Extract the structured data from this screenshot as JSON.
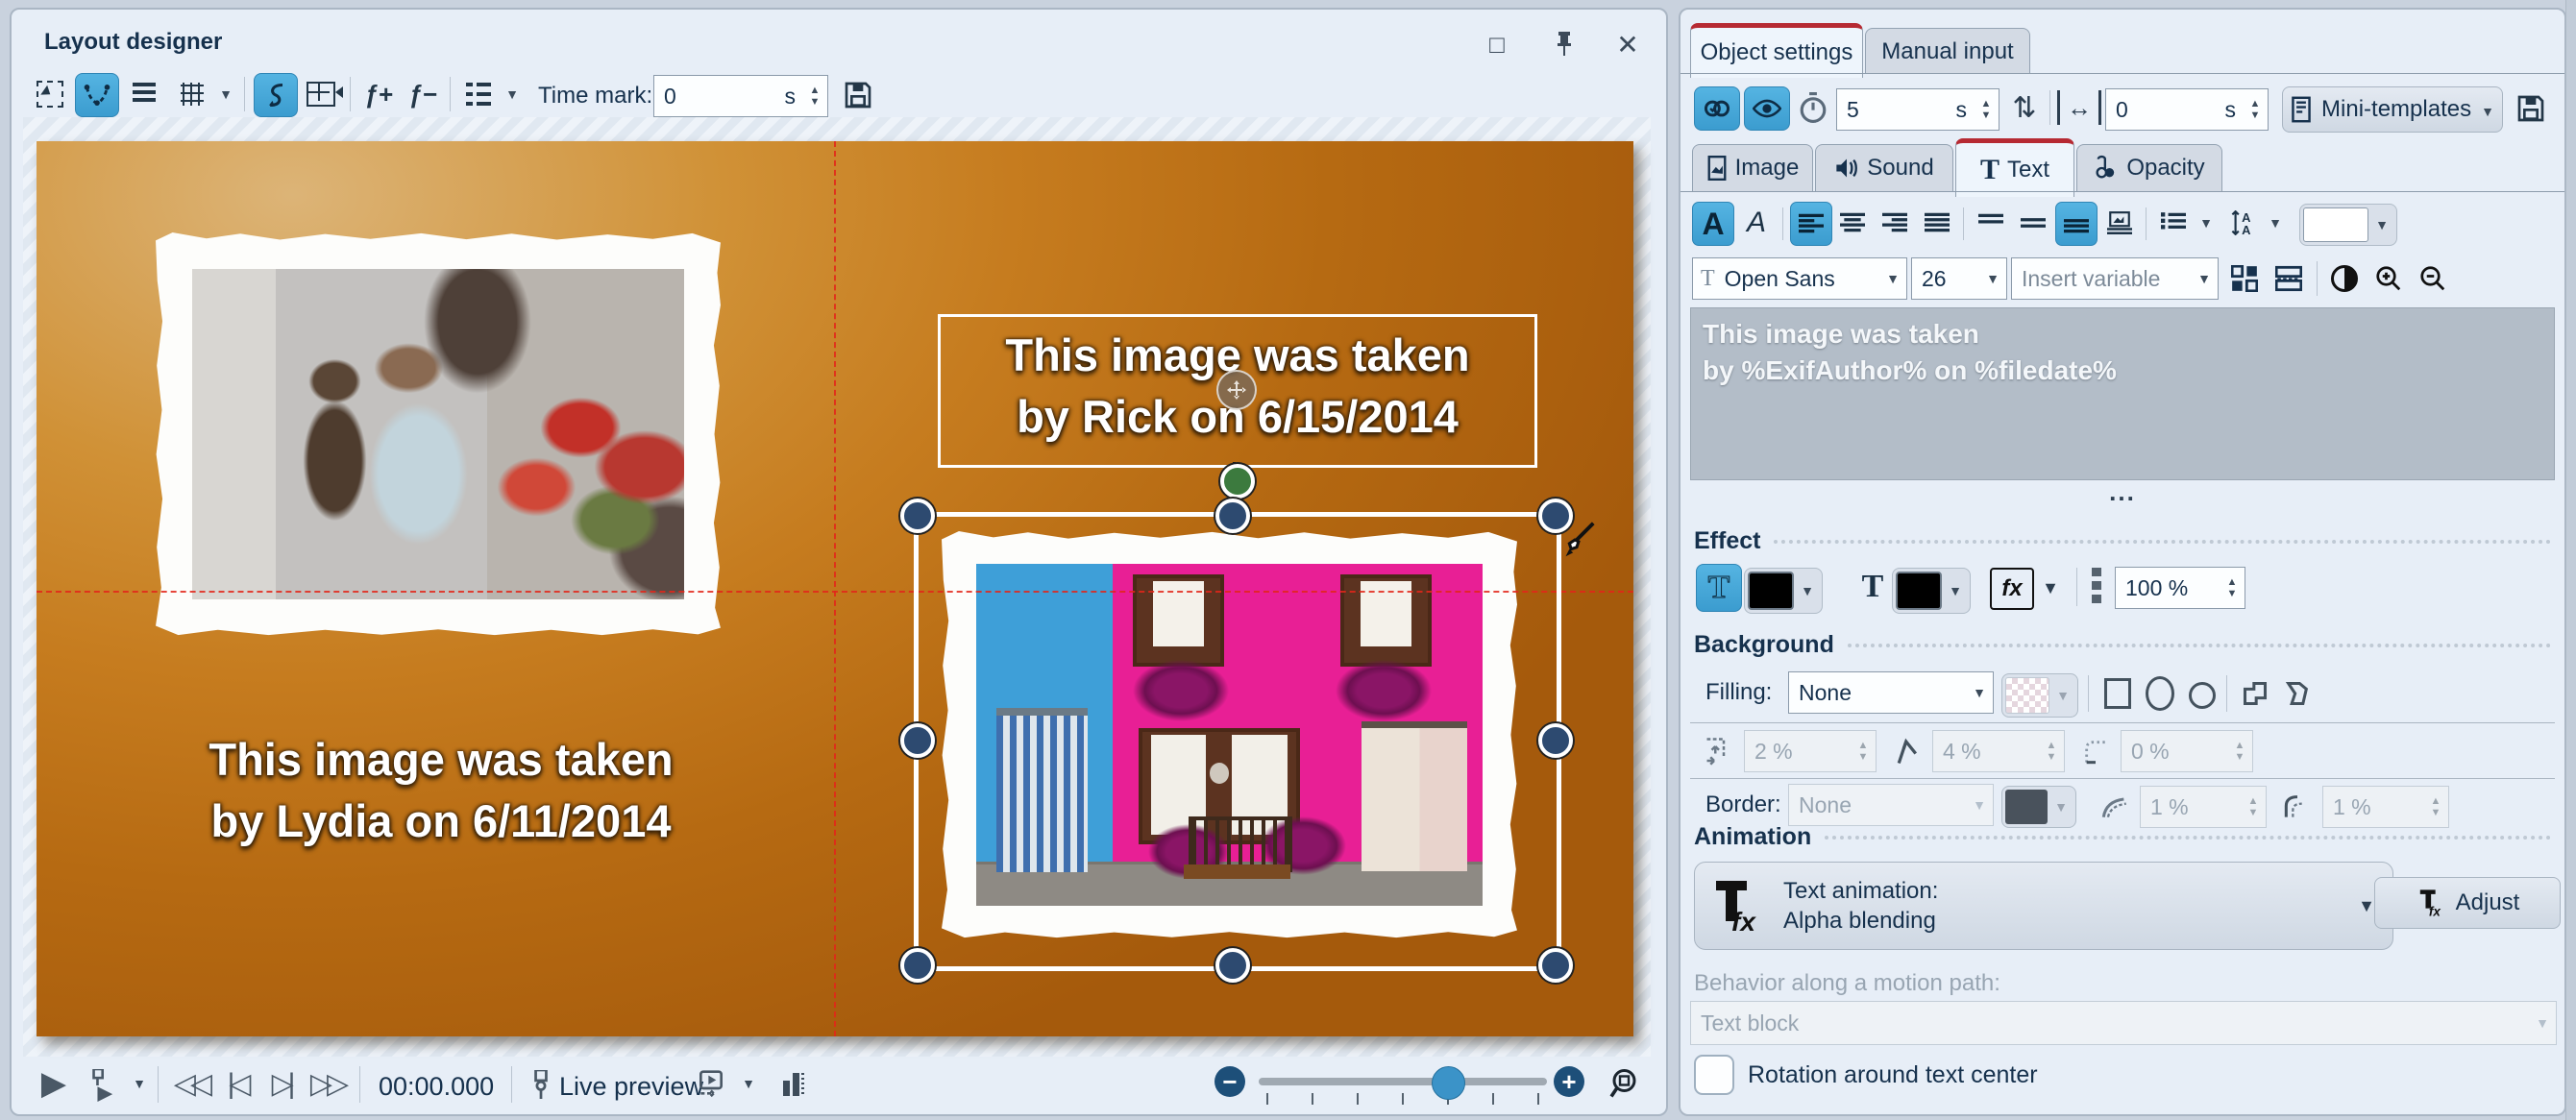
{
  "layout_designer": {
    "title": "Layout designer",
    "toolbar": {
      "time_mark_label": "Time mark:",
      "time_mark_value": "0",
      "time_mark_unit": "s"
    },
    "canvas": {
      "left_caption_line1": "This image was taken",
      "left_caption_line2": "by Lydia on 6/11/2014",
      "selected_text_line1": "This image was taken",
      "selected_text_line2": "by Rick on 6/15/2014"
    },
    "playback": {
      "time_display": "00:00.000",
      "live_preview_label": "Live preview"
    }
  },
  "object_settings": {
    "tabs": [
      {
        "label": "Object settings"
      },
      {
        "label": "Manual input"
      }
    ],
    "toolbar": {
      "duration_value": "5",
      "duration_unit": "s",
      "offset_value": "0",
      "offset_unit": "s",
      "mini_templates_label": "Mini-templates"
    },
    "content_tabs": [
      {
        "label": "Image"
      },
      {
        "label": "Sound"
      },
      {
        "label": "Text"
      },
      {
        "label": "Opacity"
      }
    ],
    "text_format": {
      "font_name": "Open Sans",
      "font_size": "26",
      "insert_variable_label": "Insert variable"
    },
    "text_editor": {
      "line1": "This image was taken",
      "line2": "by %ExifAuthor% on %filedate%",
      "expander": "..."
    },
    "effect": {
      "header": "Effect",
      "fx_label": "fx",
      "opacity_value": "100 %"
    },
    "background": {
      "header": "Background",
      "filling_label": "Filling:",
      "filling_value": "None",
      "margin_value": "2 %",
      "slant_value": "4 %",
      "corner_value": "0 %",
      "border_label": "Border:",
      "border_value": "None",
      "border_width_value": "1 %",
      "border_radius_value": "1 %"
    },
    "animation": {
      "header": "Animation",
      "text_animation_line1": "Text animation:",
      "text_animation_line2": "Alpha blending",
      "adjust_label": "Adjust",
      "behavior_label": "Behavior along a motion path:",
      "behavior_value": "Text block",
      "rotation_checkbox_label": "Rotation around text center"
    }
  },
  "icons": {
    "play": "▶",
    "rewind": "◁◁",
    "previous": "|◁",
    "next": "▷|",
    "fast_forward": "▷▷",
    "dropdown_arrow": "▼",
    "spin_up": "▲",
    "spin_down": "▼",
    "add_node": "ƒ+",
    "remove_node": "ƒ−",
    "zoom_minus": "−",
    "zoom_plus": "+",
    "maximize": "□",
    "close": "✕",
    "width_arrow": "↔",
    "reorder": "⇅"
  },
  "colors": {
    "accent_red": "#b62a33",
    "active_blue": "#45a8da",
    "panel_bg": "#e7eef7",
    "canvas_orange": "#c67c1f",
    "guide_red": "#e3261a",
    "handle_navy": "#2d4a70",
    "handle_green": "#3c7a3e",
    "editor_grey": "#b3bdc8",
    "text_white": "#ffffff"
  }
}
